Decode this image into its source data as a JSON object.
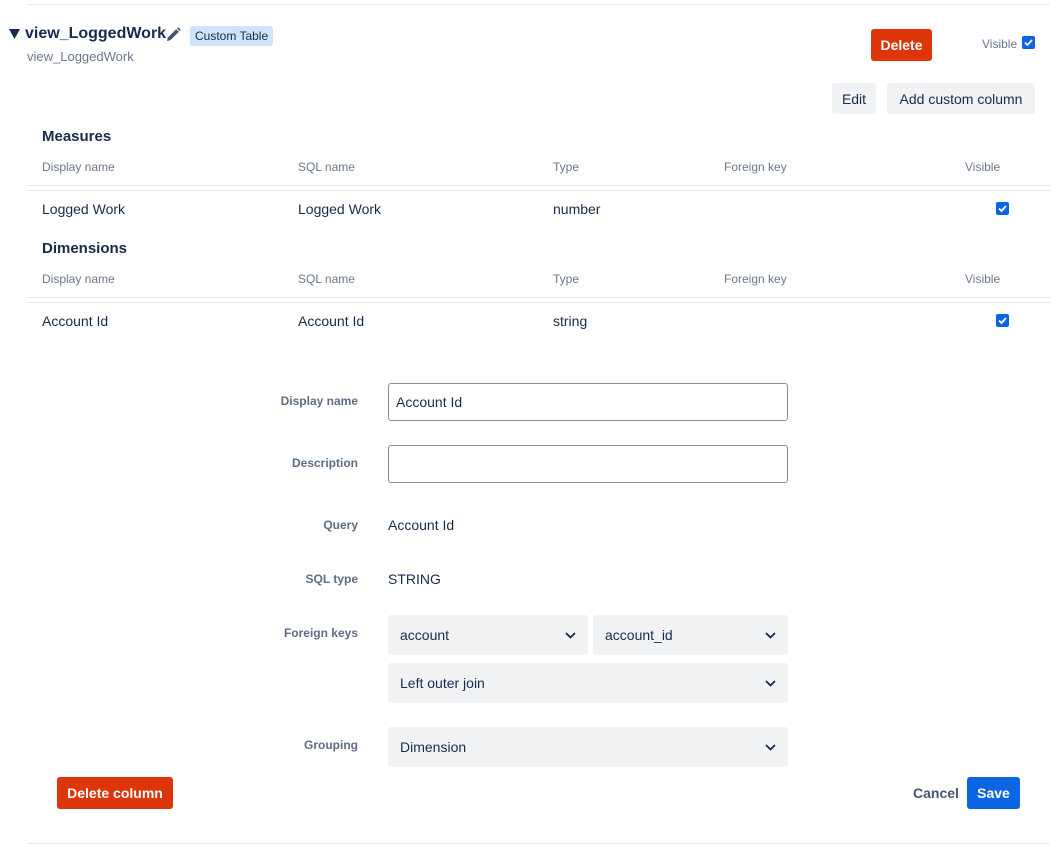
{
  "header": {
    "title": "view_LoggedWork",
    "subtitle": "view_LoggedWork",
    "badge": "Custom Table",
    "delete_label": "Delete",
    "visible_label": "Visible",
    "edit_label": "Edit",
    "add_column_label": "Add custom column"
  },
  "measures": {
    "title": "Measures",
    "headers": [
      "Display name",
      "SQL name",
      "Type",
      "Foreign key",
      "Visible"
    ],
    "rows": [
      {
        "display_name": "Logged Work",
        "sql_name": "Logged Work",
        "type": "number",
        "foreign_key": "",
        "visible": true
      }
    ]
  },
  "dimensions": {
    "title": "Dimensions",
    "headers": [
      "Display name",
      "SQL name",
      "Type",
      "Foreign key",
      "Visible"
    ],
    "rows": [
      {
        "display_name": "Account Id",
        "sql_name": "Account Id",
        "type": "string",
        "foreign_key": "",
        "visible": true
      }
    ]
  },
  "editor": {
    "display_name_label": "Display name",
    "display_name_value": "Account Id",
    "description_label": "Description",
    "description_value": "",
    "query_label": "Query",
    "query_value": "Account Id",
    "sql_type_label": "SQL type",
    "sql_type_value": "STRING",
    "foreign_keys_label": "Foreign keys",
    "fk_table": "account",
    "fk_column": "account_id",
    "fk_join": "Left outer join",
    "grouping_label": "Grouping",
    "grouping_value": "Dimension",
    "delete_column_label": "Delete column",
    "cancel_label": "Cancel",
    "save_label": "Save"
  },
  "colors": {
    "danger": "#de350b",
    "primary": "#0c66e4",
    "badge_bg": "#cfe4fb"
  }
}
